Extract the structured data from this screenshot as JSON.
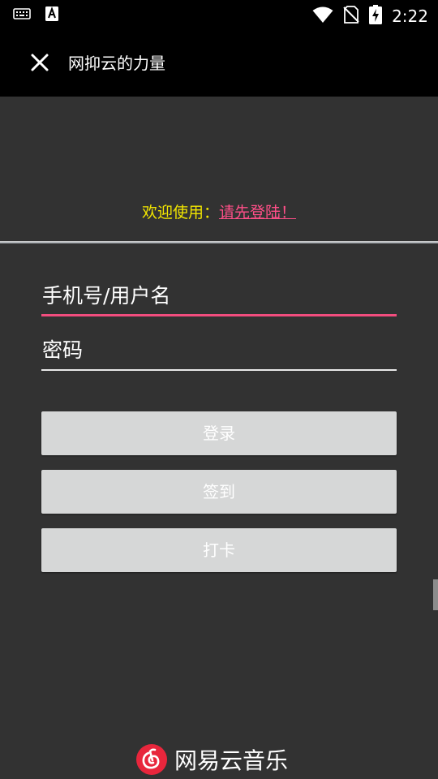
{
  "status_bar": {
    "time": "2:22",
    "icons": [
      "keyboard-icon",
      "a-notification-icon",
      "wifi-icon",
      "no-sim-icon",
      "battery-charging-icon"
    ]
  },
  "app_bar": {
    "title": "网抑云的力量",
    "close_icon": "close-icon"
  },
  "welcome": {
    "label": "欢迎使用：",
    "link": "请先登陆！"
  },
  "form": {
    "username_value": "手机号/用户名",
    "password_value": "密码"
  },
  "buttons": {
    "login": "登录",
    "checkin": "签到",
    "punch": "打卡"
  },
  "footer": {
    "brand_name": "网易云音乐"
  },
  "colors": {
    "background": "#323232",
    "bar": "#000000",
    "accent": "#f24d7e",
    "welcome_label": "#f2e600",
    "link": "#ff4f88",
    "button": "#d6d7d7",
    "brand_red": "#e8263c"
  }
}
